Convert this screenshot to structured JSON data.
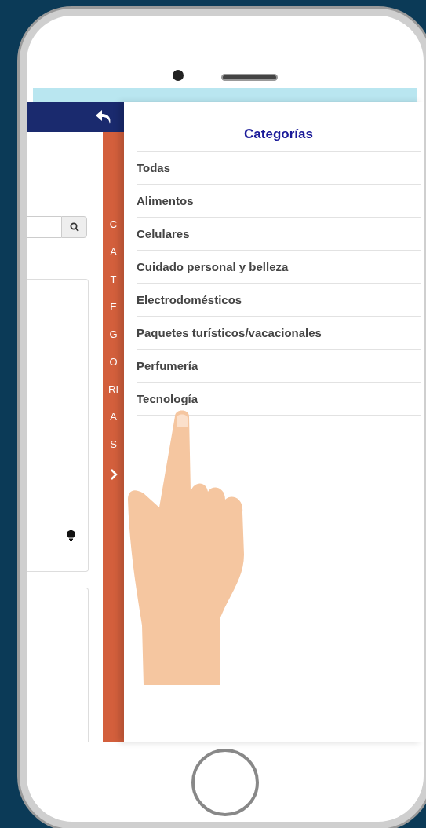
{
  "side_tab": {
    "label": "CATEGORIAS"
  },
  "panel": {
    "title": "Categorías",
    "categories": [
      "Todas",
      "Alimentos",
      "Celulares",
      "Cuidado personal y belleza",
      "Electrodomésticos",
      "Paquetes turísticos/vacacionales",
      "Perfumería",
      "Tecnología"
    ]
  }
}
